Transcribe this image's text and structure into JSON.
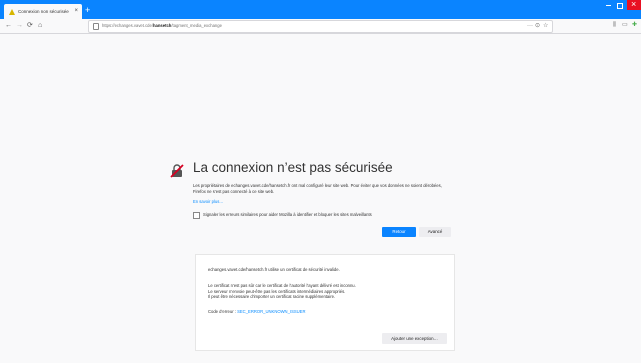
{
  "tab": {
    "title": "Connexion non sécurisée",
    "close": "×",
    "new_tab": "+"
  },
  "nav": {
    "back": "←",
    "forward": "→",
    "reload": "⟳",
    "home": "⌂",
    "url_prefix": "https://echanges.vavet.cde/",
    "url_bold": "hansetch",
    "url_suffix": "/tagment_media_exchange",
    "page_actions": "···",
    "pocket": "⊙",
    "bookmark": "☆",
    "library": "⫼",
    "sidebar": "▭",
    "extension": "✚"
  },
  "content": {
    "title": "La connexion n’est pas sécurisée",
    "description": "Les propriétaires de echanges.vavet.cde/hansetch.fr ont mal configuré leur site web. Pour éviter que vos données ne soient dérobées, Firefox ne s’est pas connecté à ce site web.",
    "learn_more": "En savoir plus…",
    "report_label": "Signaler les erreurs similaires pour aider Mozilla à identifier et bloquer les sites malveillants",
    "back_button": "Retour",
    "advanced_button": "Avancé"
  },
  "advanced": {
    "main": "echanges.vavet.cde/hansetch.fr utilise un certificat de sécurité invalide.",
    "reason1": "Le certificat n’est pas sûr car le certificat de l’autorité l’ayant délivré est inconnu.",
    "reason2": "Le serveur n’envoie peut-être pas les certificats intermédiaires appropriés.",
    "reason3": "Il peut être nécessaire d’importer un certificat racine supplémentaire.",
    "code_label": "Code d’erreur : ",
    "code_value": "SEC_ERROR_UNKNOWN_ISSUER",
    "exception_button": "Ajouter une exception…"
  },
  "colors": {
    "accent": "#0a84ff",
    "link": "#0a8dff",
    "warning": "#d7b600"
  }
}
